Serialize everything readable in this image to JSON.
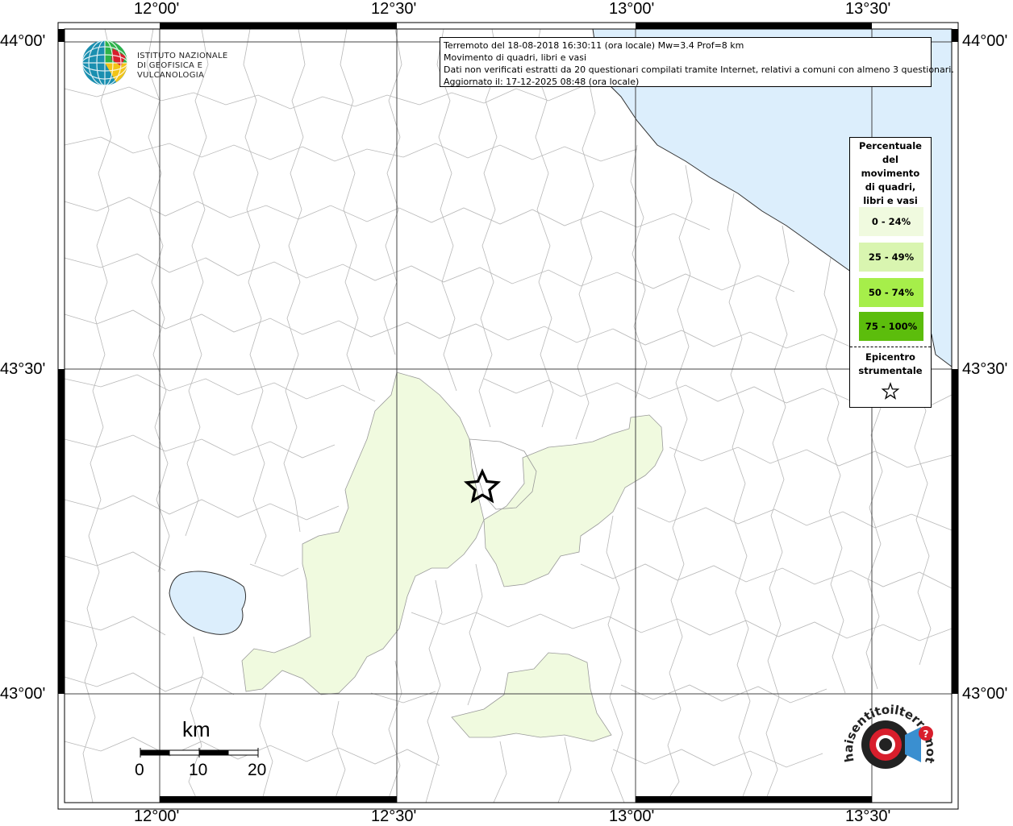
{
  "map": {
    "lon_labels": [
      "12°00'",
      "12°30'",
      "13°00'",
      "13°30'"
    ],
    "lat_labels": [
      "44°00'",
      "43°30'",
      "43°00'"
    ],
    "colors": {
      "sea": "#dceefc",
      "lake": "#dceefc",
      "reported_area": "#f0fadf",
      "borders": "#b8b8b8",
      "grid": "#444444"
    }
  },
  "info": {
    "line1": "Terremoto del 18-08-2018 16:30:11 (ora locale) Mw=3.4 Prof=8 km",
    "line2": "Movimento di quadri, libri e vasi",
    "line3": "Dati non verificati estratti da 20 questionari compilati tramite Internet, relativi a comuni con almeno 3 questionari.",
    "line4": "Aggiornato il: 17-12-2025 08:48 (ora locale)"
  },
  "logo": {
    "line1": "ISTITUTO NAZIONALE",
    "line2": "DI GEOFISICA E VULCANOLOGIA"
  },
  "legend": {
    "title_lines": [
      "Percentuale",
      "del",
      "movimento",
      "di quadri,",
      "libri e vasi"
    ],
    "classes": [
      {
        "label": "0 - 24%",
        "color": "#f0fadf"
      },
      {
        "label": "25 - 49%",
        "color": "#d9f5b0"
      },
      {
        "label": "50 - 74%",
        "color": "#a6ee4a"
      },
      {
        "label": "75 - 100%",
        "color": "#5cbd0c"
      }
    ],
    "epicenter_lines": [
      "Epicentro",
      "strumentale"
    ],
    "epicenter_icon": "star-icon"
  },
  "scale": {
    "unit": "km",
    "ticks": [
      "0",
      "10",
      "20"
    ]
  },
  "watermark": {
    "text": "haisentitoilterremoto.it",
    "icon": "loudspeaker-icon"
  }
}
